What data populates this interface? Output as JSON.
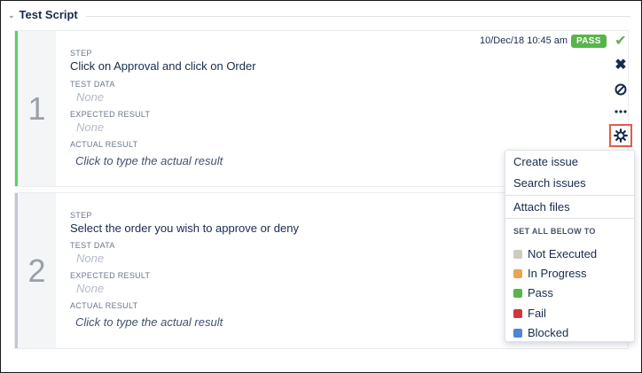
{
  "section": {
    "title": "Test Script"
  },
  "steps": [
    {
      "number": "1",
      "step_label": "STEP",
      "step_text": "Click on Approval and click on Order",
      "test_data_label": "TEST DATA",
      "test_data": "None",
      "expected_label": "EXPECTED RESULT",
      "expected": "None",
      "actual_label": "ACTUAL RESULT",
      "actual_placeholder": "Click to type the actual result",
      "timestamp": "10/Dec/18 10:45 am",
      "status_badge": "PASS",
      "status_color": "#57b54a"
    },
    {
      "number": "2",
      "step_label": "STEP",
      "step_text": "Select the order you wish to approve or deny",
      "test_data_label": "TEST DATA",
      "test_data": "None",
      "expected_label": "EXPECTED RESULT",
      "expected": "None",
      "actual_label": "ACTUAL RESULT",
      "actual_placeholder": "Click to type the actual result",
      "status_color": "#c1c7d0"
    }
  ],
  "actions": {
    "pass_icon": "check-icon",
    "fail_icon": "cross-icon",
    "block_icon": "blocked-icon",
    "more_icon": "more-icon",
    "settings_icon": "gear-icon"
  },
  "menu": {
    "items": [
      "Create issue",
      "Search issues",
      "Attach files"
    ],
    "set_all_heading": "SET ALL BELOW TO",
    "statuses": [
      {
        "label": "Not Executed",
        "color": "#cdcbc0"
      },
      {
        "label": "In Progress",
        "color": "#e8a552"
      },
      {
        "label": "Pass",
        "color": "#57b54a"
      },
      {
        "label": "Fail",
        "color": "#d0373a"
      },
      {
        "label": "Blocked",
        "color": "#4f84d8"
      }
    ]
  }
}
